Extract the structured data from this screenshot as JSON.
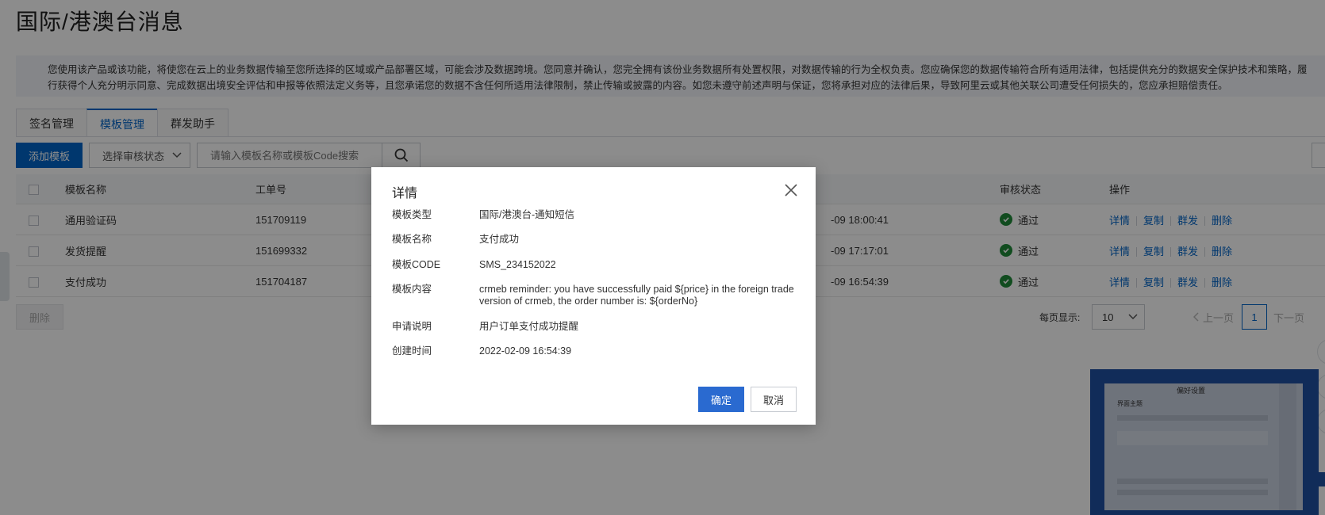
{
  "page": {
    "title": "国际/港澳台消息",
    "notice": "您使用该产品或该功能，将使您在云上的业务数据传输至您所选择的区域或产品部署区域，可能会涉及数据跨境。您同意并确认，您完全拥有该份业务数据所有处置权限，对数据传输的行为全权负责。您应确保您的数据传输符合所有适用法律，包括提供充分的数据安全保护技术和策略，履行获得个人充分明示同意、完成数据出境安全评估和申报等依照法定义务等，且您承诺您的数据不含任何所适用法律限制，禁止传输或披露的内容。如您未遵守前述声明与保证，您将承担对应的法律后果，导致阿里云或其他关联公司遭受任何损失的，您应承担赔偿责任。"
  },
  "tabs": [
    {
      "label": "签名管理",
      "active": false
    },
    {
      "label": "模板管理",
      "active": true
    },
    {
      "label": "群发助手",
      "active": false
    }
  ],
  "toolbar": {
    "add_label": "添加模板",
    "status_select": "选择审核状态",
    "search_placeholder": "请输入模板名称或模板Code搜索"
  },
  "table": {
    "headers": {
      "name": "模板名称",
      "order": "工单号",
      "status": "审核状态",
      "ops": "操作"
    },
    "rows": [
      {
        "name": "通用验证码",
        "order": "151709119",
        "time": "-09 18:00:41",
        "status": "通过"
      },
      {
        "name": "发货提醒",
        "order": "151699332",
        "time": "-09 17:17:01",
        "status": "通过"
      },
      {
        "name": "支付成功",
        "order": "151704187",
        "time": "-09 16:54:39",
        "status": "通过"
      }
    ],
    "ops": {
      "detail": "详情",
      "copy": "复制",
      "mass": "群发",
      "delete": "删除"
    }
  },
  "bottom": {
    "delete_label": "删除",
    "per_page_label": "每页显示:",
    "per_page_value": "10",
    "prev": "上一页",
    "page": "1",
    "next": "下一页"
  },
  "promo": {
    "title": "偏好设置",
    "sub": "界面主题"
  },
  "dialog": {
    "title": "详情",
    "rows": [
      {
        "label": "模板类型",
        "value": "国际/港澳台-通知短信"
      },
      {
        "label": "模板名称",
        "value": "支付成功"
      },
      {
        "label": "模板CODE",
        "value": "SMS_234152022"
      },
      {
        "label": "模板内容",
        "value": "crmeb reminder: you have successfully paid ${price} in the foreign trade version of crmeb, the order number is: ${orderNo}"
      },
      {
        "label": "申请说明",
        "value": "用户订单支付成功提醒"
      },
      {
        "label": "创建时间",
        "value": "2022-02-09 16:54:39"
      }
    ],
    "ok_label": "确定",
    "cancel_label": "取消"
  },
  "colors": {
    "primary": "#0064c8",
    "success": "#1f8a3a",
    "mask": "rgba(0,0,0,0.45)"
  }
}
